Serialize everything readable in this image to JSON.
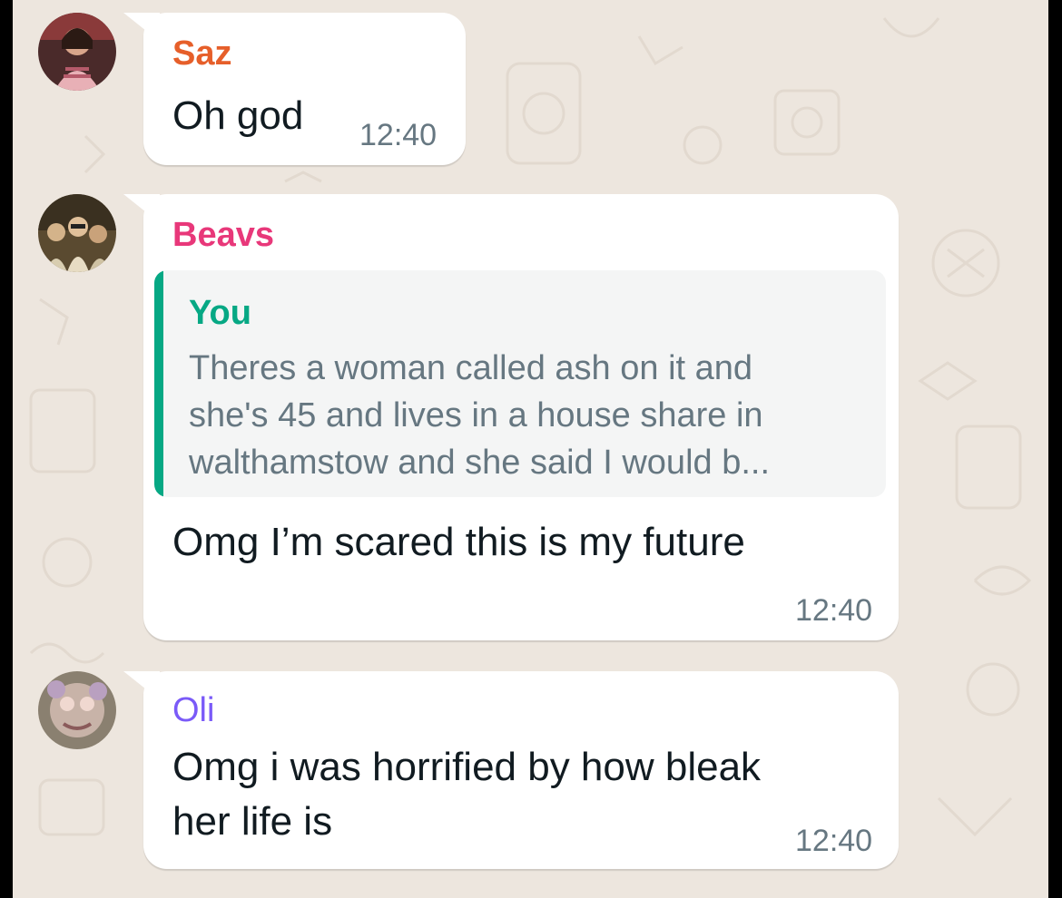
{
  "messages": [
    {
      "sender": "Saz",
      "sender_color": "#e65f2a",
      "lines": [
        "Oh god"
      ],
      "time": "12:40",
      "avatar": "profile-photo"
    },
    {
      "sender": "Beavs",
      "sender_color": "#e8387a",
      "quote": {
        "author": "You",
        "lines": [
          "Theres a woman called ash on it and",
          "she's 45 and lives in a house share in",
          "walthamstow and she said I would b..."
        ]
      },
      "lines": [
        "Omg I’m scared this is my future"
      ],
      "time": "12:40",
      "avatar": "profile-photo"
    },
    {
      "sender": "Oli",
      "sender_color": "#7a5af8",
      "lines": [
        "Omg i was horrified by how bleak",
        "her life is"
      ],
      "time": "12:40",
      "avatar": "profile-photo"
    }
  ],
  "colors": {
    "background": "#ede6de",
    "bubble": "#ffffff",
    "quote_accent": "#06a884",
    "timestamp": "#667781"
  }
}
